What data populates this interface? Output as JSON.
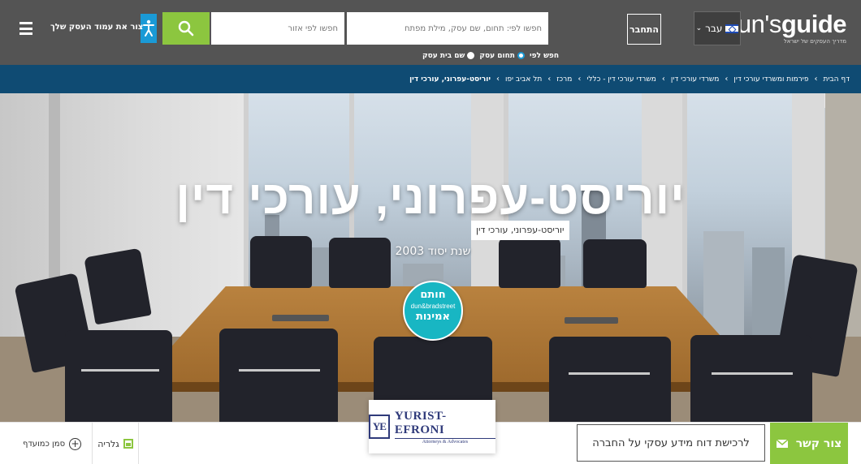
{
  "header": {
    "logo_text_left": "dun's",
    "logo_text_right": "guide",
    "logo_tagline": "מדריך העסקים של ישראל",
    "language": "עבר",
    "login_label": "התחבר",
    "search_what_placeholder": "חפשו לפי: תחום, שם עסק, מילת מפתח",
    "search_where_placeholder": "חפשו לפי אזור",
    "create_page_label": "צור את עמוד העסק שלך",
    "search_by_label": "חפש לפי",
    "search_by_options": [
      "תחום עסק",
      "שם בית עסק"
    ]
  },
  "breadcrumb": [
    "דף הבית",
    "פירמות ומשרדי עורכי דין",
    "משרדי עורכי דין",
    "משרדי עורכי דין - כללי",
    "מרכז",
    "תל אביב יפו",
    "יוריסט-עפרוני, עורכי דין"
  ],
  "hero": {
    "title": "יוריסט-עפרוני, עורכי דין",
    "subtitle": "יוריסט-עפרוני, עורכי דין",
    "founded": "שנת יסוד 2003",
    "seal": {
      "top": "חותם",
      "middle": "dun&bradstreet",
      "bottom": "אמינות"
    }
  },
  "company_logo": {
    "name": "YURIST-EFRONI",
    "tagline": "Attorneys & Advocates",
    "mark": "YE"
  },
  "actions": {
    "contact_label": "צור קשר",
    "report_label": "לרכישת דוח מידע עסקי על החברה",
    "gallery_label": "גלריה",
    "favorite_label": "סמן כמועדף"
  },
  "colors": {
    "topbar": "#545454",
    "breadcrumb_bar": "#0f4b73",
    "accent_green": "#8cc63f",
    "accent_blue": "#1a9ad6",
    "seal": "#18b6c3"
  }
}
